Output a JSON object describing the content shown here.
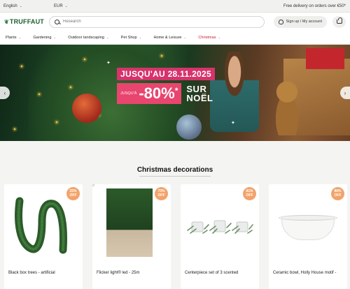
{
  "topbar": {
    "language": "English",
    "currency": "EUR",
    "delivery": "Free delivery on orders over €50*"
  },
  "header": {
    "logo": "TRUFFAUT",
    "search_placeholder": "Research",
    "account_label": "Sign up / My account"
  },
  "nav": {
    "items": [
      {
        "label": "Plants"
      },
      {
        "label": "Gardening"
      },
      {
        "label": "Outdoor landscaping"
      },
      {
        "label": "Pet Shop"
      },
      {
        "label": "Home & Leisure"
      },
      {
        "label": "Christmas"
      }
    ]
  },
  "hero": {
    "date_text": "JUSQU'AU 28.11.2025",
    "jusqua": "JUSQU'À",
    "discount": "-80%",
    "star": "*",
    "line1": "SUR",
    "line2": "NOËL"
  },
  "section": {
    "title": "Christmas decorations"
  },
  "products": [
    {
      "badge_pct": "25%",
      "badge_off": "OFF",
      "title": "Black box trees - artificial"
    },
    {
      "badge_pct": "70%",
      "badge_off": "OFF",
      "title": "Flicker light® led - 25m"
    },
    {
      "badge_pct": "81%",
      "badge_off": "OFF",
      "title": "Centerpiece set of 3 scented"
    },
    {
      "badge_pct": "88%",
      "badge_off": "OFF",
      "title": "Ceramic bowl, Holly House motif -"
    }
  ],
  "colors": {
    "brand_green": "#1d5c2e",
    "christmas_red": "#c81a2e",
    "promo_pink": "#e8456f",
    "badge_orange": "#f2a36a"
  }
}
